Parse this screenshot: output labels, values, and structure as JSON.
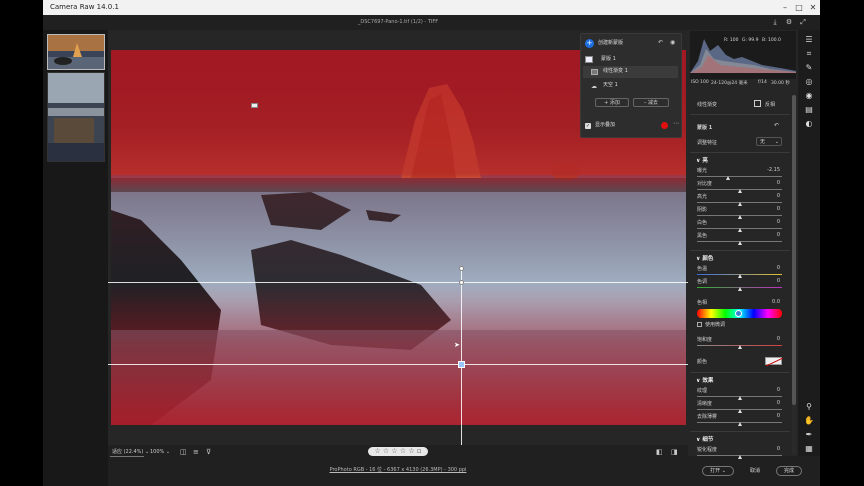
{
  "window": {
    "title": "Camera Raw 14.0.1"
  },
  "document": {
    "filename": "_DSC7697-Pano-1.tif (1/2) - TIFF"
  },
  "colors": {
    "mask_overlay": "#b4141e",
    "accent": "#1e6fe0",
    "panel_bg": "#262626"
  },
  "masks_panel": {
    "create_label": "创建新蒙版",
    "items": [
      "蒙版 1",
      "线性渐变 1",
      "天空 1"
    ],
    "add_label": "添加",
    "subtract_label": "减去",
    "show_overlay_label": "显示叠加"
  },
  "histogram": {
    "rgb": [
      "R: 100",
      "G: 99.9",
      "B: 100.0"
    ],
    "camera_info": [
      "ISO 100",
      "24-120@24 毫米",
      "f/14",
      "30.00 秒"
    ]
  },
  "right_panel": {
    "title": "线性渐变",
    "invert_label": "反相",
    "mask_name": "蒙版 1",
    "preset_label": "调整特征",
    "preset_value": "无",
    "light": {
      "title": "亮",
      "sliders": [
        {
          "label": "曝光",
          "value": "-2.15",
          "pos": 0.36
        },
        {
          "label": "对比度",
          "value": "0",
          "pos": 0.5
        },
        {
          "label": "高光",
          "value": "0",
          "pos": 0.5
        },
        {
          "label": "阴影",
          "value": "0",
          "pos": 0.5
        },
        {
          "label": "白色",
          "value": "0",
          "pos": 0.5
        },
        {
          "label": "黑色",
          "value": "0",
          "pos": 0.5
        }
      ]
    },
    "color": {
      "title": "颜色",
      "sliders": [
        {
          "label": "色温",
          "value": "0",
          "pos": 0.5
        },
        {
          "label": "色调",
          "value": "0",
          "pos": 0.5
        }
      ],
      "hue": {
        "label": "色相",
        "value": "0.0"
      },
      "fine_label": "使用微调",
      "saturation": {
        "label": "饱和度",
        "value": "0",
        "pos": 0.5
      },
      "color_label": "颜色"
    },
    "effects": {
      "title": "效果",
      "sliders": [
        {
          "label": "纹理",
          "value": "0",
          "pos": 0.5
        },
        {
          "label": "清晰度",
          "value": "0",
          "pos": 0.5
        },
        {
          "label": "去除薄雾",
          "value": "0",
          "pos": 0.5
        }
      ]
    },
    "detail": {
      "title": "细节",
      "sliders": [
        {
          "label": "锐化程度",
          "value": "0",
          "pos": 0.5
        }
      ]
    }
  },
  "bottom": {
    "fit_label": "适应 (22.4%)",
    "zoom_label": "100%",
    "stars": "☆ ☆ ☆ ☆ ☆",
    "file_info": "ProPhoto RGB - 16 位 - 6367 x 4130 (26.3MP) - 300 ppi"
  },
  "footer": {
    "open_label": "打开",
    "cancel_label": "取消",
    "done_label": "完成"
  }
}
